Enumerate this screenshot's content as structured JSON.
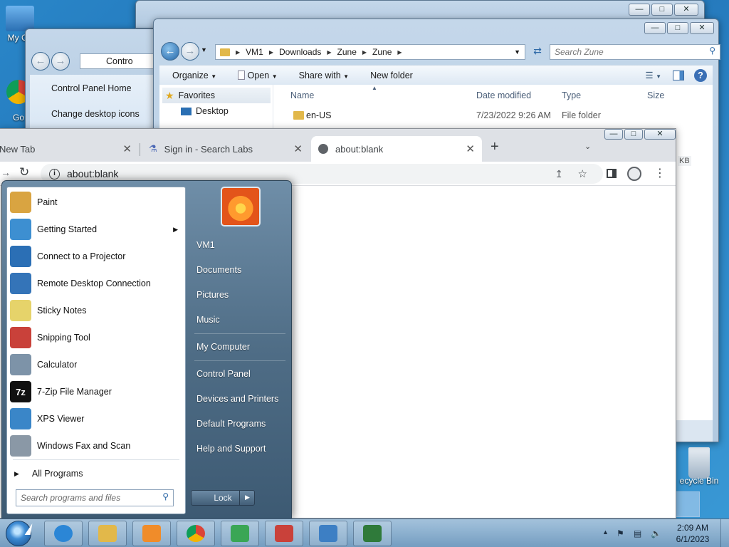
{
  "desktop": {
    "icons": [
      {
        "label": "My Co",
        "name": "my-computer"
      },
      {
        "label": "Go",
        "name": "google-chrome-shortcut"
      },
      {
        "label": "ecycle Bin",
        "name": "recycle-bin"
      }
    ]
  },
  "control_panel": {
    "address": "Contro",
    "links": [
      "Control Panel Home",
      "Change desktop icons"
    ]
  },
  "explorer": {
    "breadcrumbs": [
      "VM1",
      "Downloads",
      "Zune",
      "Zune"
    ],
    "search_placeholder": "Search Zune",
    "toolbar": [
      "Organize",
      "Open",
      "Share with",
      "New folder"
    ],
    "nav": {
      "favorites": "Favorites",
      "desktop": "Desktop"
    },
    "columns": {
      "name": "Name",
      "date": "Date modified",
      "type": "Type",
      "size": "Size"
    },
    "files": [
      {
        "name": "en-US",
        "date": "7/23/2022 9:26 AM",
        "type": "File folder",
        "size": ""
      }
    ],
    "partial_size": "KB"
  },
  "chrome": {
    "tabs": [
      {
        "title": "New Tab",
        "active": false
      },
      {
        "title": "Sign in - Search Labs",
        "active": false
      },
      {
        "title": "about:blank",
        "active": true
      }
    ],
    "new_tab": "+",
    "url": "about:blank"
  },
  "start_menu": {
    "programs": [
      {
        "label": "Paint",
        "icon": "paint-icon",
        "color": "#d9a441",
        "has_submenu": false
      },
      {
        "label": "Getting Started",
        "icon": "getting-started-icon",
        "color": "#3d8fd1",
        "has_submenu": true
      },
      {
        "label": "Connect to a Projector",
        "icon": "projector-icon",
        "color": "#2b6fb5",
        "has_submenu": false
      },
      {
        "label": "Remote Desktop Connection",
        "icon": "remote-desktop-icon",
        "color": "#3474b8",
        "has_submenu": false
      },
      {
        "label": "Sticky Notes",
        "icon": "sticky-notes-icon",
        "color": "#e6d36a",
        "has_submenu": false
      },
      {
        "label": "Snipping Tool",
        "icon": "scissors-icon",
        "color": "#c9413a",
        "has_submenu": false
      },
      {
        "label": "Calculator",
        "icon": "calculator-icon",
        "color": "#7d93a8",
        "has_submenu": false
      },
      {
        "label": "7-Zip File Manager",
        "icon": "7zip-icon",
        "color": "#111111",
        "glyph": "7z",
        "has_submenu": false
      },
      {
        "label": "XPS Viewer",
        "icon": "xps-viewer-icon",
        "color": "#3a86c8",
        "has_submenu": false
      },
      {
        "label": "Windows Fax and Scan",
        "icon": "fax-icon",
        "color": "#8a98a6",
        "has_submenu": false
      }
    ],
    "all_programs": "All Programs",
    "search_placeholder": "Search programs and files",
    "right": [
      "VM1",
      "Documents",
      "Pictures",
      "Music",
      "My Computer",
      "Control Panel",
      "Devices and Printers",
      "Default Programs",
      "Help and Support"
    ],
    "lock": "Lock"
  },
  "taskbar": {
    "apps": [
      {
        "name": "internet-explorer",
        "color": "#2b86d6"
      },
      {
        "name": "file-explorer",
        "color": "#e2b84a"
      },
      {
        "name": "media-player",
        "color": "#f08c2a"
      },
      {
        "name": "google-chrome",
        "color": "#db4437"
      },
      {
        "name": "app-green",
        "color": "#3aa655"
      },
      {
        "name": "app-red",
        "color": "#c9413a"
      },
      {
        "name": "control-panel",
        "color": "#3d7fc4"
      },
      {
        "name": "task-manager",
        "color": "#2f7a3a"
      }
    ],
    "time": "2:09 AM",
    "date": "6/1/2023"
  }
}
